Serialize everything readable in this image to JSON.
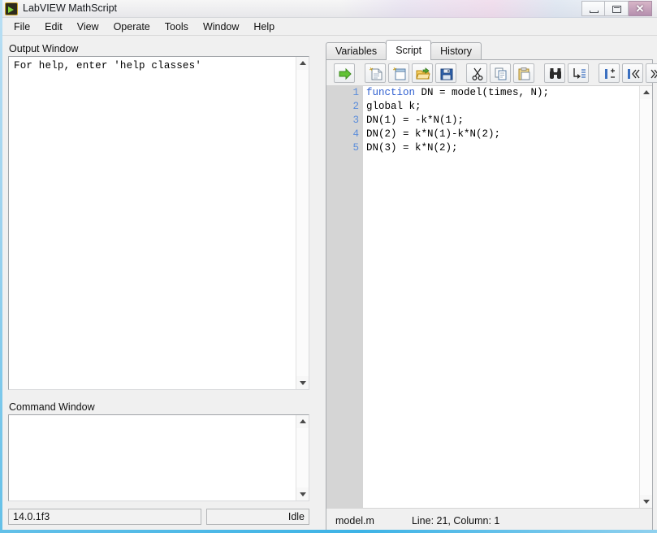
{
  "window": {
    "title": "LabVIEW MathScript",
    "icon": "labview-icon",
    "controls": {
      "minimize": "minimize-button",
      "maximize": "maximize-button",
      "close_glyph": "✕"
    }
  },
  "menubar": {
    "items": [
      {
        "label": "File"
      },
      {
        "label": "Edit"
      },
      {
        "label": "View"
      },
      {
        "label": "Operate"
      },
      {
        "label": "Tools"
      },
      {
        "label": "Window"
      },
      {
        "label": "Help"
      }
    ]
  },
  "left_pane": {
    "output_window": {
      "label": "Output Window",
      "text": "For help, enter 'help classes'"
    },
    "command_window": {
      "label": "Command Window",
      "text": ""
    },
    "footer": {
      "version": "14.0.1f3",
      "status": "Idle"
    }
  },
  "right_pane": {
    "tabs": [
      {
        "label": "Variables",
        "active": false
      },
      {
        "label": "Script",
        "active": true
      },
      {
        "label": "History",
        "active": false
      }
    ],
    "toolbar": [
      {
        "name": "run-script-button",
        "title": "Run script"
      },
      {
        "name": "new-script-button",
        "title": "New script"
      },
      {
        "name": "new-window-button",
        "title": "New window"
      },
      {
        "name": "open-file-button",
        "title": "Open"
      },
      {
        "name": "save-file-button",
        "title": "Save"
      },
      {
        "name": "cut-button",
        "title": "Cut"
      },
      {
        "name": "copy-button",
        "title": "Copy"
      },
      {
        "name": "paste-button",
        "title": "Paste"
      },
      {
        "name": "find-button",
        "title": "Find"
      },
      {
        "name": "goto-line-button",
        "title": "Go to line"
      },
      {
        "name": "toggle-breakpoint-button",
        "title": "Toggle breakpoint"
      },
      {
        "name": "step-back-button",
        "title": "Step back"
      },
      {
        "name": "step-forward-button",
        "title": "Step forward"
      }
    ],
    "editor": {
      "lines": [
        {
          "num": "1",
          "keyword": "function",
          "rest": " DN = model(times, N);"
        },
        {
          "num": "2",
          "keyword": "",
          "rest": "global k;"
        },
        {
          "num": "3",
          "keyword": "",
          "rest": "DN(1) = -k*N(1);"
        },
        {
          "num": "4",
          "keyword": "",
          "rest": "DN(2) = k*N(1)-k*N(2);"
        },
        {
          "num": "5",
          "keyword": "",
          "rest": "DN(3) = k*N(2);"
        }
      ]
    },
    "status": {
      "filename": "model.m",
      "position": "Line: 21, Column: 1"
    }
  },
  "colors": {
    "accent_blue": "#3db3e6",
    "keyword": "#2f5fd0",
    "line_number": "#5b8ddb",
    "run_arrow_green": "#5fbf2e",
    "gutter": "#d5d5d5"
  }
}
